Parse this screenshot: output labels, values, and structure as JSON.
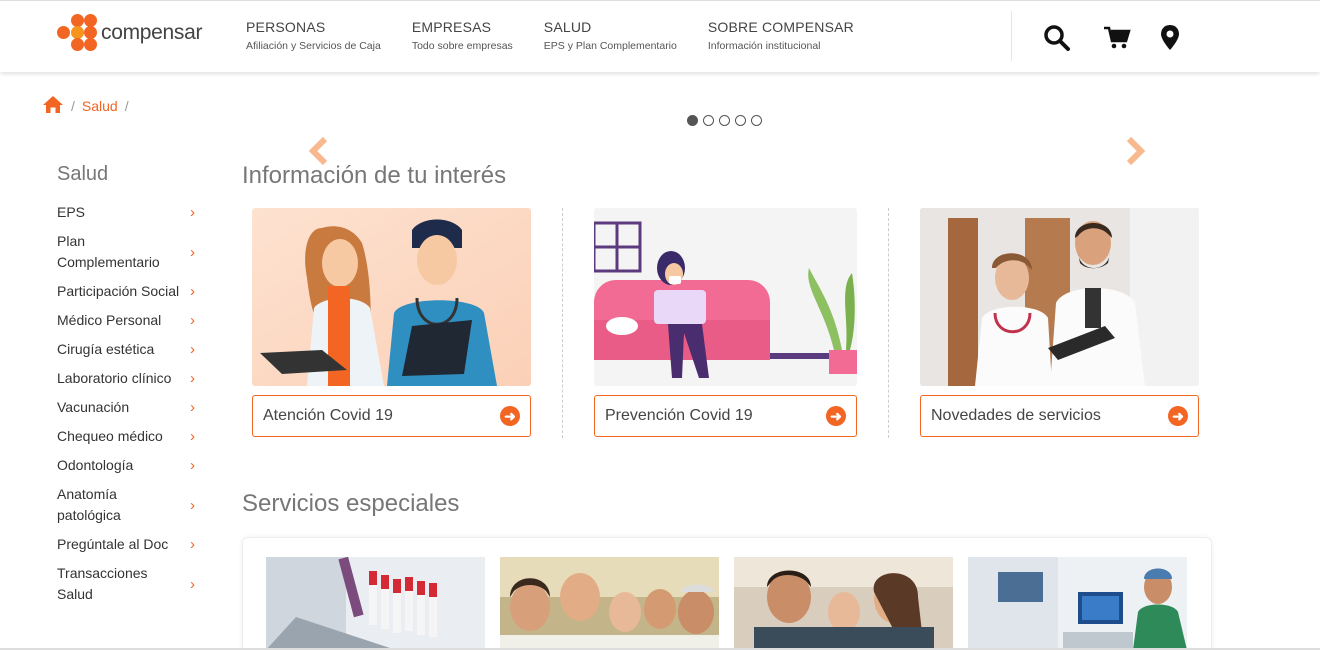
{
  "brand": {
    "name": "compensar",
    "accent": "#f26522"
  },
  "nav": [
    {
      "title": "PERSONAS",
      "sub": "Afiliación y Servicios de Caja"
    },
    {
      "title": "EMPRESAS",
      "sub": "Todo sobre empresas"
    },
    {
      "title": "SALUD",
      "sub": "EPS y Plan Complementario"
    },
    {
      "title": "SOBRE COMPENSAR",
      "sub": "Información institucional"
    }
  ],
  "header_icons": [
    "search-icon",
    "cart-icon",
    "location-pin-icon"
  ],
  "breadcrumb": {
    "home_icon": "home-icon",
    "current": "Salud",
    "separator": "/"
  },
  "carousel": {
    "slides": 5,
    "active": 1
  },
  "sidebar": {
    "title": "Salud",
    "items": [
      "EPS",
      "Plan Complementario",
      "Participación Social",
      "Médico Personal",
      "Cirugía estética",
      "Laboratorio clínico",
      "Vacunación",
      "Chequeo médico",
      "Odontología",
      "Anatomía patológica",
      "Pregúntale al Doc",
      "Transacciones Salud"
    ]
  },
  "info": {
    "title": "Información de tu interés",
    "cards": [
      {
        "label": "Atención Covid 19"
      },
      {
        "label": "Prevención Covid 19"
      },
      {
        "label": "Novedades de servicios"
      }
    ]
  },
  "services": {
    "title": "Servicios especiales"
  }
}
